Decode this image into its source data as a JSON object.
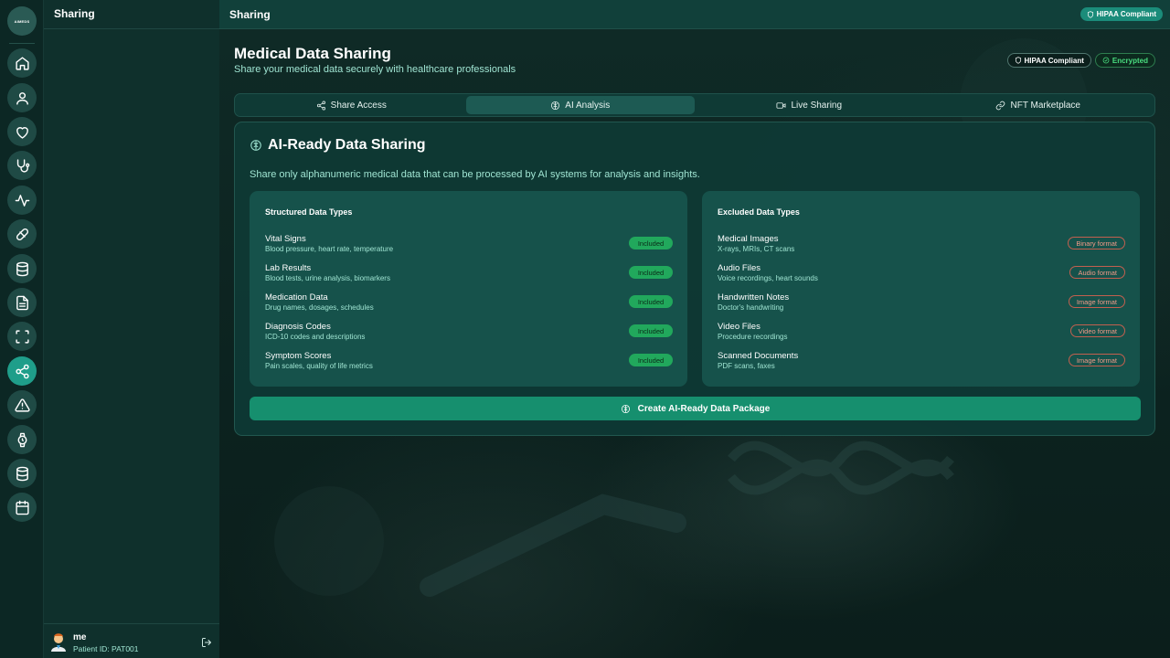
{
  "app": {
    "logo_text": "AIMEDS"
  },
  "rail": {
    "items": [
      {
        "name": "home-icon"
      },
      {
        "name": "user-icon"
      },
      {
        "name": "heart-icon"
      },
      {
        "name": "stethoscope-icon"
      },
      {
        "name": "activity-icon"
      },
      {
        "name": "pill-icon"
      },
      {
        "name": "database-icon"
      },
      {
        "name": "file-text-icon"
      },
      {
        "name": "scan-icon"
      },
      {
        "name": "share-icon",
        "active": true
      },
      {
        "name": "alert-triangle-icon"
      },
      {
        "name": "watch-icon"
      },
      {
        "name": "database-icon"
      },
      {
        "name": "calendar-icon"
      }
    ]
  },
  "sidebar": {
    "title": "Sharing",
    "user": {
      "name": "me",
      "patient_id": "Patient ID: PAT001"
    }
  },
  "topbar": {
    "title": "Sharing",
    "badge": "HIPAA Compliant"
  },
  "header": {
    "title": "Medical Data Sharing",
    "subtitle": "Share your medical data securely with healthcare professionals",
    "badges": {
      "hipaa": "HIPAA Compliant",
      "encrypted": "Encrypted"
    }
  },
  "tabs": [
    {
      "label": "Share Access",
      "icon": "share-icon",
      "active": false
    },
    {
      "label": "AI Analysis",
      "icon": "brain-icon",
      "active": true
    },
    {
      "label": "Live Sharing",
      "icon": "video-icon",
      "active": false
    },
    {
      "label": "NFT Marketplace",
      "icon": "link-icon",
      "active": false
    }
  ],
  "card": {
    "title": "AI-Ready Data Sharing",
    "description": "Share only alphanumeric medical data that can be processed by AI systems for analysis and insights.",
    "structured": {
      "title": "Structured Data Types",
      "items": [
        {
          "name": "Vital Signs",
          "desc": "Blood pressure, heart rate, temperature",
          "tag": "Included"
        },
        {
          "name": "Lab Results",
          "desc": "Blood tests, urine analysis, biomarkers",
          "tag": "Included"
        },
        {
          "name": "Medication Data",
          "desc": "Drug names, dosages, schedules",
          "tag": "Included"
        },
        {
          "name": "Diagnosis Codes",
          "desc": "ICD-10 codes and descriptions",
          "tag": "Included"
        },
        {
          "name": "Symptom Scores",
          "desc": "Pain scales, quality of life metrics",
          "tag": "Included"
        }
      ]
    },
    "excluded": {
      "title": "Excluded Data Types",
      "items": [
        {
          "name": "Medical Images",
          "desc": "X-rays, MRIs, CT scans",
          "tag": "Binary format"
        },
        {
          "name": "Audio Files",
          "desc": "Voice recordings, heart sounds",
          "tag": "Audio format"
        },
        {
          "name": "Handwritten Notes",
          "desc": "Doctor's handwriting",
          "tag": "Image format"
        },
        {
          "name": "Video Files",
          "desc": "Procedure recordings",
          "tag": "Video format"
        },
        {
          "name": "Scanned Documents",
          "desc": "PDF scans, faxes",
          "tag": "Image format"
        }
      ]
    },
    "cta": "Create AI-Ready Data Package"
  },
  "colors": {
    "accent": "#1f9e8a",
    "included": "#21a85c",
    "excluded": "#c2604f",
    "cta": "#168f6e"
  }
}
